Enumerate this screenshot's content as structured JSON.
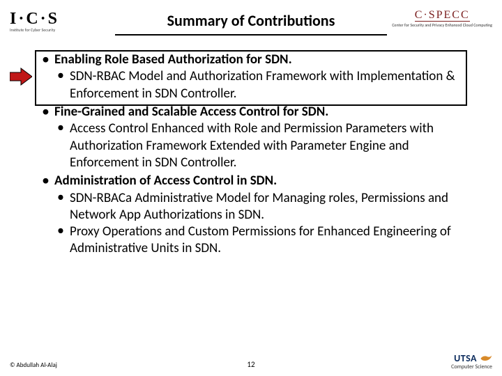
{
  "header": {
    "logo_left": {
      "text": "I·C·S",
      "tagline": "Institute for Cyber Security"
    },
    "title": "Summary of Contributions",
    "logo_right": {
      "text": "C·SPECC",
      "tagline": "Center for Security and Privacy Enhanced Cloud Computing"
    }
  },
  "bullets": [
    {
      "head": "Enabling Role Based Authorization for SDN.",
      "subs": [
        "SDN-RBAC Model and Authorization Framework with Implementation & Enforcement in SDN Controller."
      ],
      "highlighted": true
    },
    {
      "head": "Fine-Grained and Scalable Access Control for SDN.",
      "subs": [
        "Access Control Enhanced with Role and Permission Parameters with Authorization Framework Extended with Parameter Engine and Enforcement in SDN Controller."
      ],
      "highlighted": false
    },
    {
      "head": "Administration of Access Control in SDN.",
      "subs": [
        "SDN-RBACa Administrative Model for Managing roles, Permissions and Network App Authorizations in SDN.",
        "Proxy Operations and Custom Permissions for Enhanced Engineering of Administrative Units in SDN."
      ],
      "highlighted": false
    }
  ],
  "footer": {
    "author": "© Abdullah Al-Alaj",
    "page": "12",
    "org": "UTSA",
    "dept": "Computer Science"
  },
  "icons": {
    "arrow": "arrow-right-icon",
    "bird": "bird-icon"
  }
}
